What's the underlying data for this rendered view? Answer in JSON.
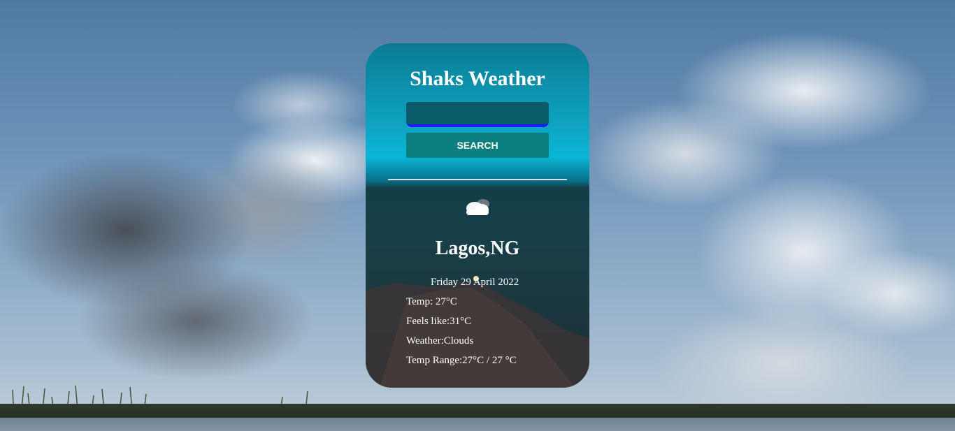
{
  "app": {
    "title": "Shaks Weather"
  },
  "search": {
    "value": "",
    "placeholder": "",
    "button_label": "SEARCH"
  },
  "weather": {
    "icon": "cloud-icon",
    "city": "Lagos,NG",
    "date": "Friday 29 April 2022",
    "temp": "Temp: 27°C",
    "feels_like": "Feels like:31°C",
    "condition": "Weather:Clouds",
    "temp_range": "Temp Range:27°C / 27 °C"
  },
  "colors": {
    "card_top": "#0bb6d6",
    "button": "#0a7f80",
    "input_border": "#1a1aff",
    "text": "#ffffff"
  }
}
